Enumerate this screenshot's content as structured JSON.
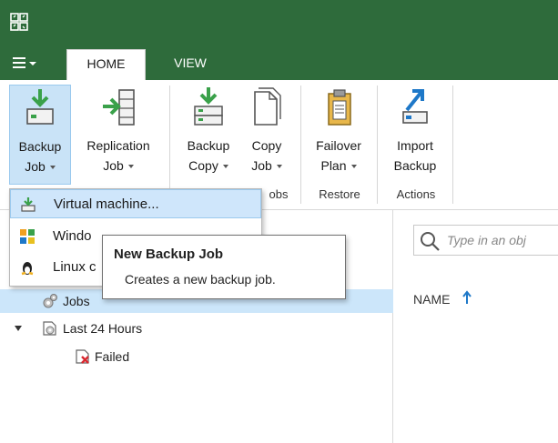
{
  "tabs": {
    "menu": "menu",
    "home": "HOME",
    "view": "VIEW"
  },
  "ribbon": {
    "backup_job": {
      "line1": "Backup",
      "line2": "Job"
    },
    "replication_job": {
      "line1": "Replication",
      "line2": "Job"
    },
    "backup_copy": {
      "line1": "Backup",
      "line2": "Copy"
    },
    "copy_job": {
      "line1": "Copy",
      "line2": "Job"
    },
    "failover_plan": {
      "line1": "Failover",
      "line2": "Plan"
    },
    "import_backup": {
      "line1": "Import",
      "line2": "Backup"
    },
    "groups": {
      "jobs": "obs",
      "restore": "Restore",
      "actions": "Actions"
    }
  },
  "dropdown": {
    "items": [
      {
        "label": "Virtual machine...",
        "icon": "vm-backup-icon"
      },
      {
        "label": "Windo",
        "icon": "windows-icon"
      },
      {
        "label": "Linux c",
        "icon": "linux-icon"
      }
    ]
  },
  "tooltip": {
    "title": "New Backup Job",
    "body": "Creates a new backup job."
  },
  "tree": {
    "jobs": "Jobs",
    "last24": "Last 24 Hours",
    "failed": "Failed"
  },
  "search": {
    "placeholder": "Type in an obj"
  },
  "table": {
    "column_name": "NAME"
  },
  "colors": {
    "titlebar": "#2e6b3b",
    "selection": "#cce6fa",
    "accent": "#1e78c8",
    "green_icon": "#3aa14a"
  }
}
